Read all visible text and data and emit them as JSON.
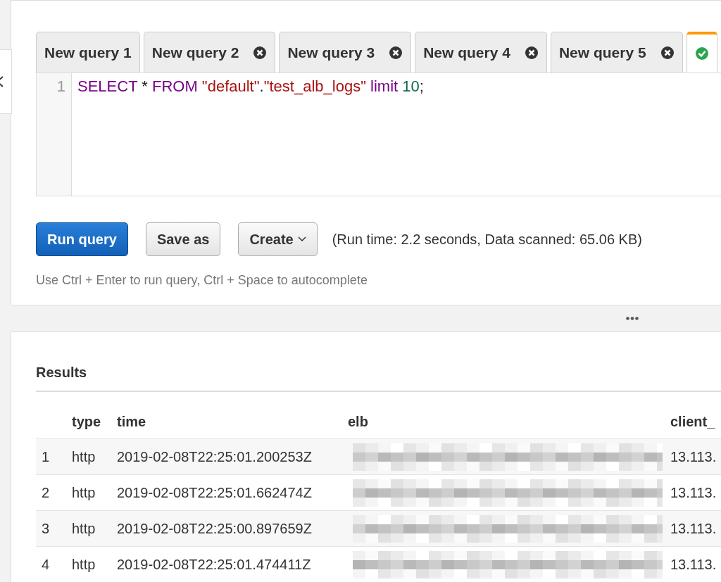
{
  "tabs": [
    {
      "label": "New query 1",
      "closable": false,
      "selected": false
    },
    {
      "label": "New query 2",
      "closable": true,
      "selected": false
    },
    {
      "label": "New query 3",
      "closable": true,
      "selected": false
    },
    {
      "label": "New query 4",
      "closable": true,
      "selected": false
    },
    {
      "label": "New query 5",
      "closable": true,
      "selected": false
    },
    {
      "closable": false,
      "selected": true
    }
  ],
  "editor": {
    "lines": [
      {
        "number": "1",
        "tokens": [
          {
            "text": "SELECT",
            "kind": "keyword"
          },
          {
            "text": " * ",
            "kind": "plain"
          },
          {
            "text": "FROM",
            "kind": "keyword"
          },
          {
            "text": " \"default\"",
            "kind": "string"
          },
          {
            "text": ".",
            "kind": "plain"
          },
          {
            "text": "\"test_alb_logs\"",
            "kind": "string"
          },
          {
            "text": " limit",
            "kind": "keyword"
          },
          {
            "text": " 10",
            "kind": "number"
          },
          {
            "text": ";",
            "kind": "plain"
          }
        ]
      }
    ]
  },
  "buttons": [
    {
      "label": "Run query",
      "kind": "primary"
    },
    {
      "label": "Save as",
      "kind": "secondary"
    },
    {
      "label": "Create",
      "kind": "dropdown"
    }
  ],
  "run_info": "(Run time: 2.2 seconds, Data scanned: 65.06 KB)",
  "hint": "Use Ctrl + Enter to run query, Ctrl + Space to autocomplete",
  "results": {
    "title": "Results",
    "columns": [
      "",
      "type",
      "time",
      "elb",
      "client_"
    ],
    "rows": [
      {
        "number": "1",
        "type": "http",
        "time": "2019-02-08T22:25:01.200253Z",
        "elb_redacted": true,
        "client": "13.113."
      },
      {
        "number": "2",
        "type": "http",
        "time": "2019-02-08T22:25:01.662474Z",
        "elb_redacted": true,
        "client": "13.113."
      },
      {
        "number": "3",
        "type": "http",
        "time": "2019-02-08T22:25:00.897659Z",
        "elb_redacted": true,
        "client": "13.113."
      },
      {
        "number": "4",
        "type": "http",
        "time": "2019-02-08T22:25:01.474411Z",
        "elb_redacted": true,
        "client": "13.113."
      }
    ]
  }
}
